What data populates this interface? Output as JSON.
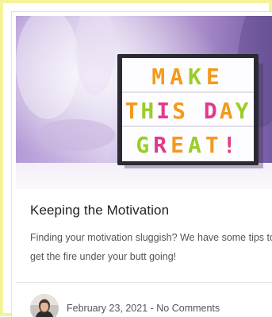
{
  "hero": {
    "sign_lines": [
      "MAKE",
      "THIS DAY",
      "GREAT!"
    ],
    "colors": {
      "orange": "#f39a1c",
      "green": "#9ccc2a",
      "magenta": "#e23a8a",
      "purple": "#7b4fc9"
    }
  },
  "post": {
    "title": "Keeping the Motivation",
    "excerpt": "Finding your motivation sluggish? We have some tips to get the fire under your butt going!",
    "date": "February 23, 2021",
    "separator": " - ",
    "comments": "No Comments"
  },
  "colors": {
    "frame": "#f5f39a",
    "title": "#222222",
    "body_text": "#555555"
  }
}
